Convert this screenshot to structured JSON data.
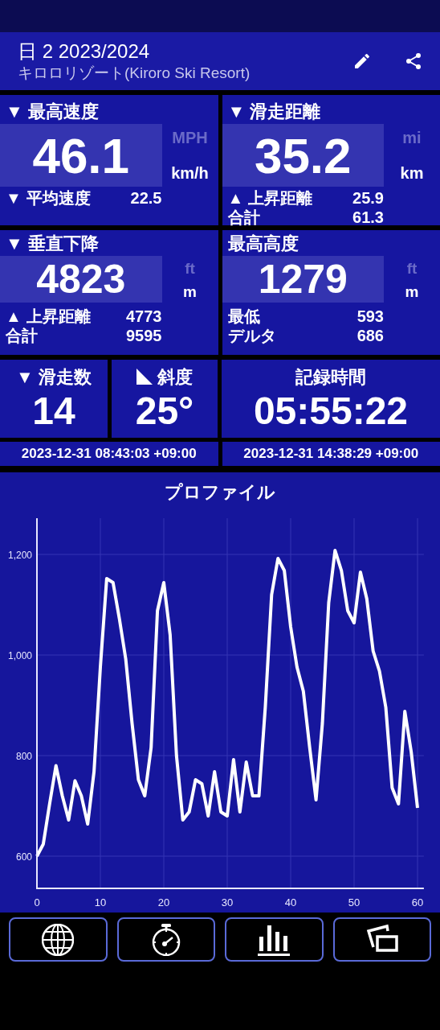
{
  "header": {
    "title": "日 2 2023/2024",
    "subtitle": "キロロリゾート(Kiroro Ski Resort)"
  },
  "stat_cards": [
    {
      "marker": "▼",
      "title": "最高速度",
      "value": "46.1",
      "units": [
        {
          "label": "MPH",
          "selected": false
        },
        {
          "label": "km/h",
          "selected": true
        }
      ],
      "rows": [
        {
          "marker": "▼",
          "label": "平均速度",
          "value": "22.5"
        }
      ]
    },
    {
      "marker": "▼",
      "title": "滑走距離",
      "value": "35.2",
      "units": [
        {
          "label": "mi",
          "selected": false
        },
        {
          "label": "km",
          "selected": true
        }
      ],
      "rows": [
        {
          "marker": "▲",
          "label": "上昇距離",
          "value": "25.9"
        },
        {
          "label": "合計",
          "value": "61.3"
        }
      ]
    },
    {
      "marker": "▼",
      "title": "垂直下降",
      "value": "4823",
      "units": [
        {
          "label": "ft",
          "selected": false
        },
        {
          "label": "m",
          "selected": true
        }
      ],
      "rows": [
        {
          "marker": "▲",
          "label": "上昇距離",
          "value": "4773"
        },
        {
          "label": "合計",
          "value": "9595"
        }
      ]
    },
    {
      "title": "最高高度",
      "value": "1279",
      "units": [
        {
          "label": "ft",
          "selected": false
        },
        {
          "label": "m",
          "selected": true
        }
      ],
      "rows": [
        {
          "label": "最低",
          "value": "593"
        },
        {
          "label": "デルタ",
          "value": "686"
        }
      ]
    }
  ],
  "small_cards": [
    {
      "kind": "runs",
      "marker": "▼",
      "title": "滑走数",
      "value": "14"
    },
    {
      "kind": "slope",
      "title": "斜度",
      "value": "25°"
    },
    {
      "kind": "duration",
      "title": "記録時間",
      "value": "05:55:22"
    }
  ],
  "timestamps": [
    "2023-12-31 08:43:03 +09:00",
    "2023-12-31 14:38:29 +09:00"
  ],
  "profile": {
    "chart_data": {
      "type": "line",
      "title": "プロファイル",
      "x": [
        0,
        1,
        2,
        3,
        4,
        5,
        6,
        7,
        8,
        9,
        10,
        11,
        12,
        13,
        14,
        15,
        16,
        17,
        18,
        19,
        20,
        21,
        22,
        23,
        24,
        25,
        26,
        27,
        28,
        29,
        30,
        31,
        32,
        33,
        34,
        35,
        36,
        37,
        38,
        39,
        40,
        41,
        42,
        43,
        44,
        45,
        46,
        47,
        48,
        49,
        50,
        51,
        52,
        53,
        54,
        55,
        56,
        57,
        58,
        59,
        60
      ],
      "grid": true,
      "series": [
        {
          "color": "#ffffff",
          "values": [
            600,
            624,
            704,
            780,
            720,
            672,
            750,
            720,
            664,
            768,
            976,
            1152,
            1144,
            1072,
            992,
            864,
            752,
            720,
            816,
            1088,
            1144,
            1040,
            800,
            672,
            688,
            752,
            744,
            680,
            768,
            688,
            680,
            792,
            688,
            787,
            720,
            720,
            896,
            1120,
            1192,
            1168,
            1056,
            976,
            928,
            816,
            712,
            864,
            1104,
            1208,
            1168,
            1088,
            1064,
            1165,
            1112,
            1008,
            968,
            896,
            736,
            704,
            888,
            808,
            696
          ]
        }
      ],
      "xlim": [
        0,
        61
      ],
      "ylim": [
        536,
        1272
      ],
      "xticks": [
        0,
        10,
        20,
        30,
        40,
        50,
        60
      ],
      "yticks": [
        {
          "value": 600,
          "label": "600"
        },
        {
          "value": 800,
          "label": "800"
        },
        {
          "value": 1000,
          "label": "1,000"
        },
        {
          "value": 1200,
          "label": "1,200"
        }
      ]
    }
  },
  "nav": [
    {
      "kind": "globe"
    },
    {
      "kind": "stopwatch"
    },
    {
      "kind": "bars"
    },
    {
      "kind": "screens"
    }
  ]
}
